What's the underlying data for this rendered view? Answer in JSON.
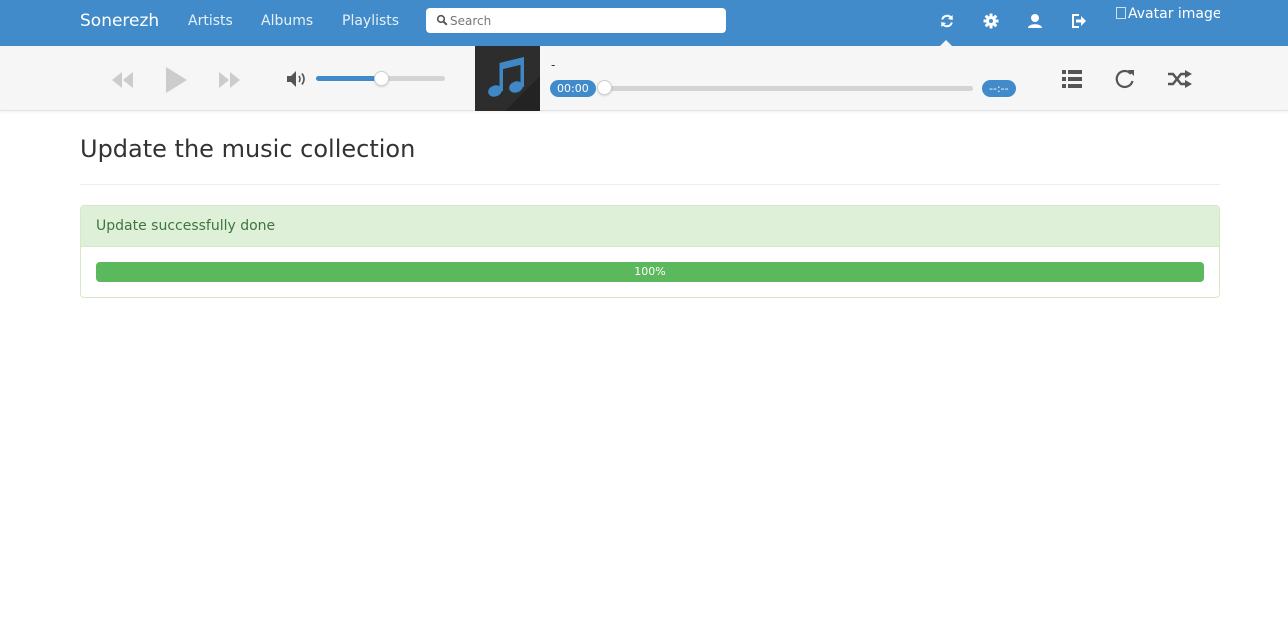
{
  "navbar": {
    "brand": "Sonerezh",
    "links": [
      "Artists",
      "Albums",
      "Playlists"
    ],
    "search_placeholder": "Search",
    "avatar_alt": "Avatar image",
    "icons": [
      "refresh-icon",
      "gear-icon",
      "user-icon",
      "logout-icon"
    ]
  },
  "player": {
    "track_title": "-",
    "current_time": "00:00",
    "duration": "--:--",
    "volume_level": 0.5,
    "track_progress": 0
  },
  "content": {
    "title": "Update the music collection",
    "status_message": "Update successfully done",
    "progress_label": "100%",
    "progress_value": 100
  },
  "colors": {
    "primary": "#428bca",
    "success": "#5cb85c",
    "success_bg": "#dff0d8",
    "success_text": "#3c763d"
  }
}
